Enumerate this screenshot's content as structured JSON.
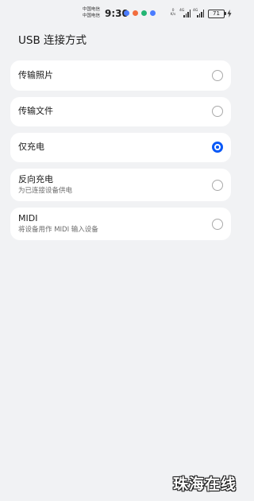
{
  "status_bar": {
    "carriers": [
      "中国电信",
      "中国电信"
    ],
    "time": "9:30",
    "notification_icons": [
      {
        "name": "app-notification-icon",
        "color": "#4a7cff"
      },
      {
        "name": "app-notification-icon",
        "color": "#f26d3d"
      },
      {
        "name": "app-notification-icon",
        "color": "#22b573"
      },
      {
        "name": "app-notification-icon",
        "color": "#4a7cff"
      }
    ],
    "net_speed_value": "0",
    "net_speed_unit": "K/s",
    "signal_1_label": "4G",
    "signal_2_label": "4G",
    "battery_level": "71",
    "charging": true
  },
  "page": {
    "title": "USB 连接方式"
  },
  "options": [
    {
      "title": "传输照片",
      "subtitle": "",
      "selected": false
    },
    {
      "title": "传输文件",
      "subtitle": "",
      "selected": false
    },
    {
      "title": "仅充电",
      "subtitle": "",
      "selected": true
    },
    {
      "title": "反向充电",
      "subtitle": "为已连接设备供电",
      "selected": false
    },
    {
      "title": "MIDI",
      "subtitle": "将设备用作 MIDI 输入设备",
      "selected": false
    }
  ],
  "watermark": "珠海在线",
  "colors": {
    "background": "#f1f2f4",
    "card": "#ffffff",
    "accent": "#0a59f7",
    "radio_unselected": "#a9a9a9"
  }
}
